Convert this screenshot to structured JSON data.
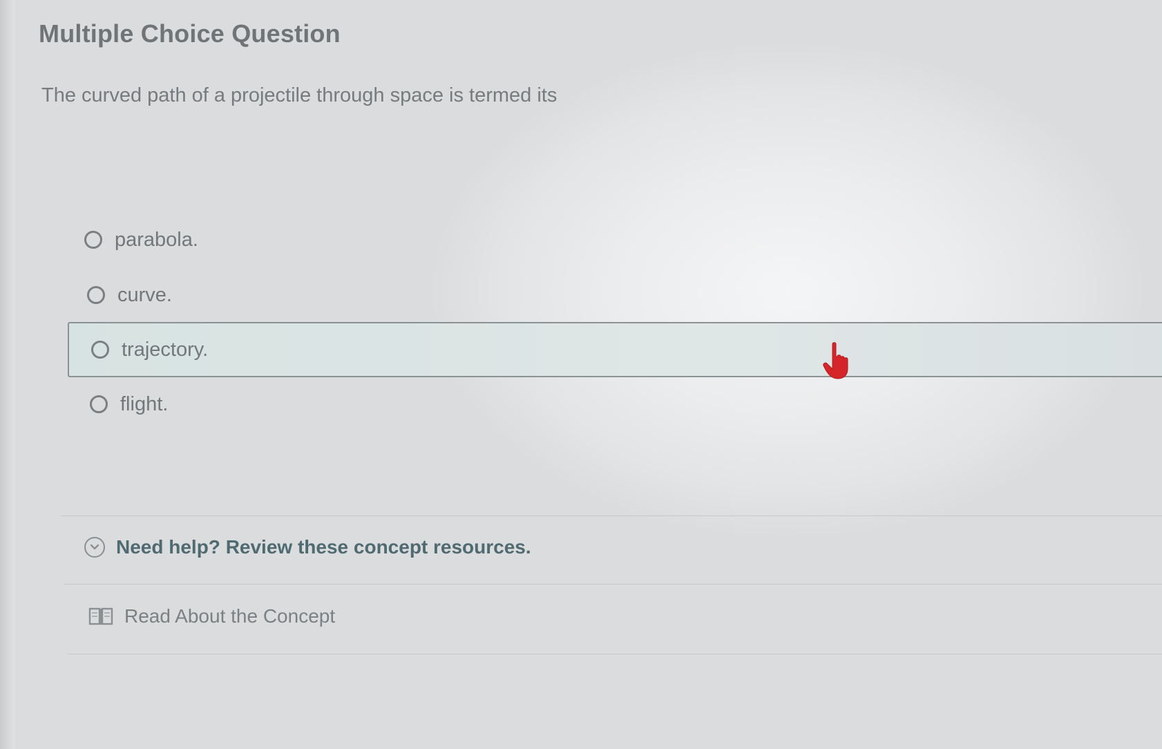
{
  "question": {
    "type_label": "Multiple Choice Question",
    "prompt": "The curved path of a projectile through space is termed its"
  },
  "options": [
    {
      "label": "parabola.",
      "hovered": false
    },
    {
      "label": "curve.",
      "hovered": false
    },
    {
      "label": "trajectory.",
      "hovered": true
    },
    {
      "label": "flight.",
      "hovered": false
    }
  ],
  "help": {
    "toggle_label": "Need help? Review these concept resources.",
    "resources": [
      {
        "label": "Read About the Concept",
        "icon": "book-icon"
      }
    ]
  },
  "cursor": {
    "icon": "hand-pointer-icon",
    "color": "#d4252a"
  },
  "colors": {
    "hover_background": "#dbe4e3",
    "help_text": "#4f6a70"
  }
}
